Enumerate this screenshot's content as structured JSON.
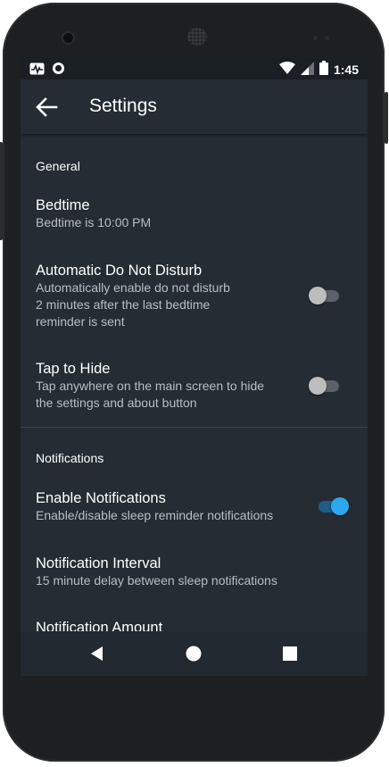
{
  "status_bar": {
    "time": "1:45",
    "left_icons": [
      "activity-icon",
      "circle-status-icon"
    ],
    "right_icons": [
      "wifi-icon",
      "signal-icon",
      "battery-icon"
    ]
  },
  "app_bar": {
    "title": "Settings",
    "back_icon": "arrow-left-icon"
  },
  "sections": {
    "general": {
      "header": "General",
      "items": [
        {
          "title": "Bedtime",
          "summary": "Bedtime is 10:00 PM"
        },
        {
          "title": "Automatic Do Not Disturb",
          "summary_lines": [
            "Automatically enable do not disturb",
            "2 minutes after the last bedtime",
            "reminder is sent"
          ],
          "switch_on": false
        },
        {
          "title": "Tap to Hide",
          "summary_lines": [
            "Tap anywhere on the main screen to hide",
            "the settings and about button"
          ],
          "switch_on": false
        }
      ]
    },
    "notifications": {
      "header": "Notifications",
      "items": [
        {
          "title": "Enable Notifications",
          "summary": "Enable/disable sleep reminder notifications",
          "switch_on": true
        },
        {
          "title": "Notification Interval",
          "summary": "15 minute delay between sleep notifications"
        },
        {
          "title": "Notification Amount"
        }
      ]
    }
  },
  "colors": {
    "background": "#252c33",
    "accent": "#2ea7ef",
    "secondary_text": "#b9bec3"
  },
  "nav_bar": {
    "icons": [
      "back-triangle-icon",
      "home-circle-icon",
      "recents-square-icon"
    ]
  }
}
